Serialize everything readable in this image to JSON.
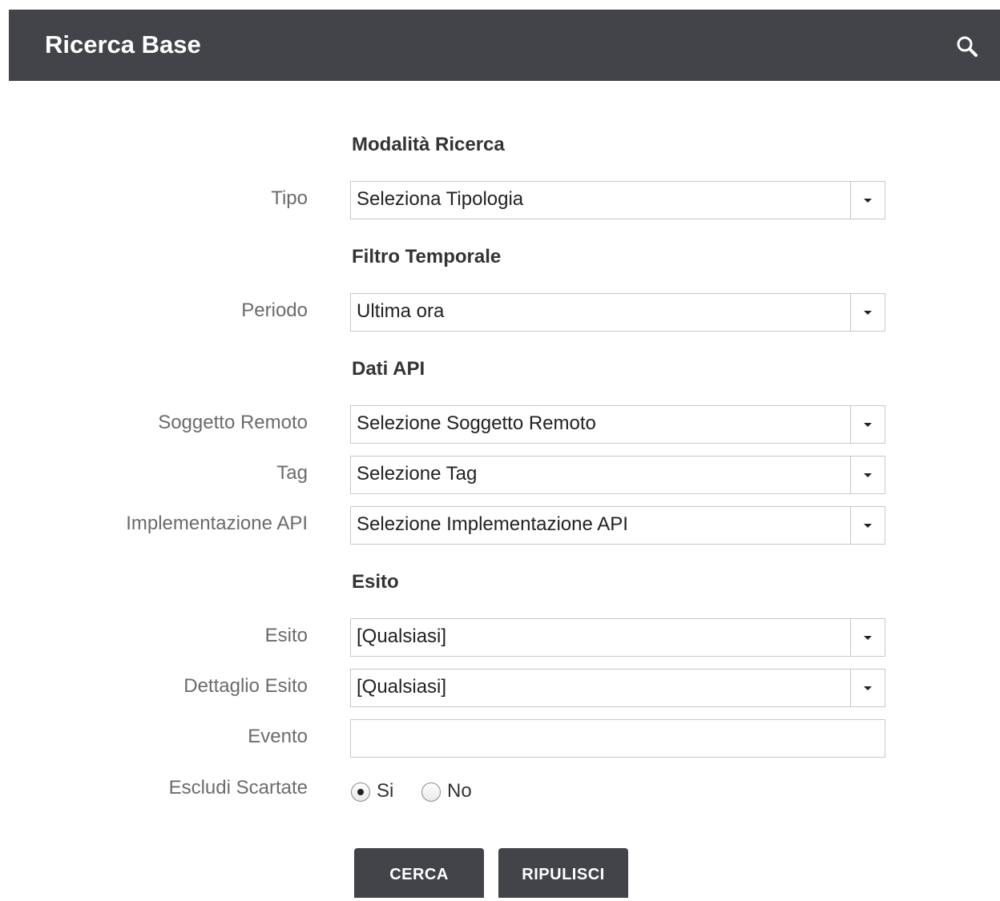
{
  "header": {
    "title": "Ricerca Base",
    "search_icon": "search-icon"
  },
  "sections": {
    "modalita": "Modalità Ricerca",
    "filtro": "Filtro Temporale",
    "dati_api": "Dati API",
    "esito": "Esito"
  },
  "fields": {
    "tipo": {
      "label": "Tipo",
      "value": "Seleziona Tipologia"
    },
    "periodo": {
      "label": "Periodo",
      "value": "Ultima ora"
    },
    "soggetto": {
      "label": "Soggetto Remoto",
      "value": "Selezione Soggetto Remoto"
    },
    "tag": {
      "label": "Tag",
      "value": "Selezione Tag"
    },
    "implementazione": {
      "label": "Implementazione API",
      "value": "Selezione Implementazione API"
    },
    "esito": {
      "label": "Esito",
      "value": "[Qualsiasi]"
    },
    "dettaglio": {
      "label": "Dettaglio Esito",
      "value": "[Qualsiasi]"
    },
    "evento": {
      "label": "Evento",
      "value": ""
    },
    "escludi": {
      "label": "Escludi Scartate",
      "options": [
        "Si",
        "No"
      ],
      "selected": "Si"
    }
  },
  "buttons": {
    "cerca": "CERCA",
    "ripulisci": "RIPULISCI"
  },
  "colors": {
    "header_bg": "#434449",
    "button_bg": "#434449"
  }
}
